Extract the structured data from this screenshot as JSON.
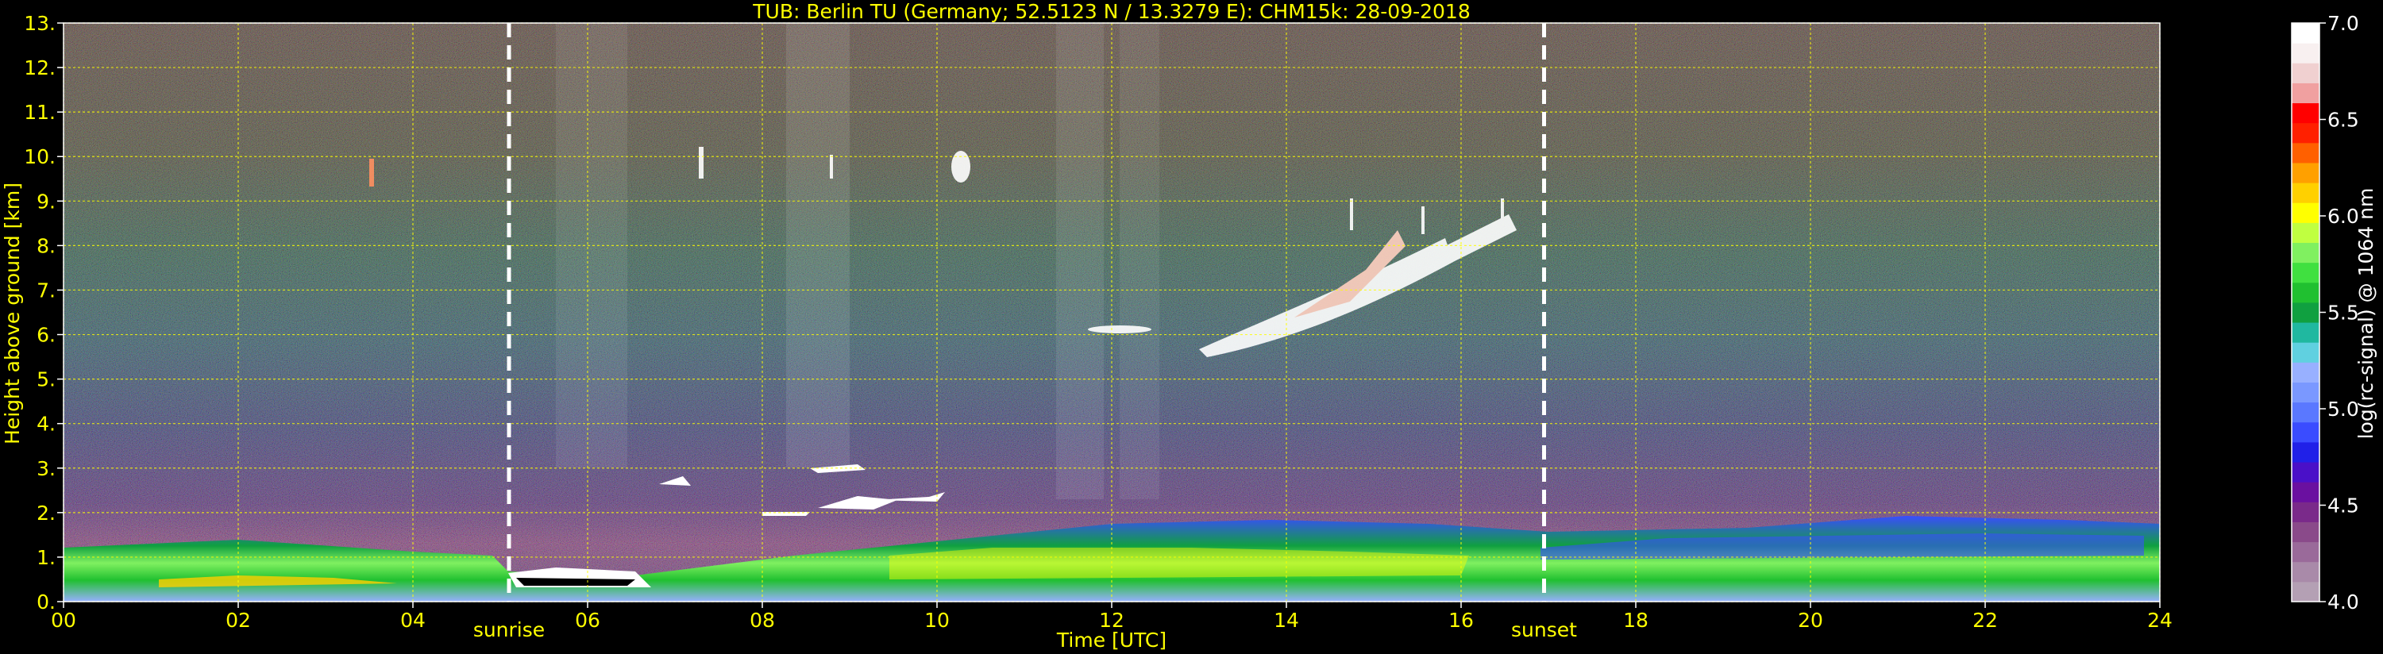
{
  "title": "TUB: Berlin TU (Germany; 52.5123 N / 13.3279 E):    CHM15k: 28-09-2018",
  "chart_data": {
    "type": "heatmap",
    "title": "TUB: Berlin TU (Germany; 52.5123 N / 13.3279 E):    CHM15k: 28-09-2018",
    "xlabel": "Time [UTC]",
    "ylabel": "Height above ground [km]",
    "xlim": [
      0,
      24
    ],
    "ylim": [
      0,
      13
    ],
    "x_ticks": [
      0,
      2,
      4,
      6,
      8,
      10,
      12,
      14,
      16,
      18,
      20,
      22,
      24
    ],
    "x_tick_labels": [
      "00",
      "02",
      "04",
      "06",
      "08",
      "10",
      "12",
      "14",
      "16",
      "18",
      "20",
      "22",
      "24"
    ],
    "y_ticks": [
      0,
      1,
      2,
      3,
      4,
      5,
      6,
      7,
      8,
      9,
      10,
      11,
      12,
      13
    ],
    "y_tick_labels": [
      "0.",
      "1.",
      "2.",
      "3.",
      "4.",
      "5.",
      "6.",
      "7.",
      "8.",
      "9.",
      "10.",
      "11.",
      "12.",
      "13."
    ],
    "grid": true,
    "colorbar": {
      "label": "log(rc-signal) @ 1064 nm",
      "range": [
        4.0,
        7.0
      ],
      "ticks": [
        4.0,
        4.5,
        5.0,
        5.5,
        6.0,
        6.5,
        7.0
      ],
      "tick_labels": [
        "4.0",
        "4.5",
        "5.0",
        "5.5",
        "6.0",
        "6.5",
        "7.0"
      ],
      "colors": [
        "#b4a0b4",
        "#a98aa9",
        "#9a6a9a",
        "#8a4a8a",
        "#7a2a8a",
        "#6a10a0",
        "#4a10c8",
        "#2020e8",
        "#3a4cff",
        "#5a78ff",
        "#7a98ff",
        "#98b0ff",
        "#60d0e0",
        "#20b8a0",
        "#10a040",
        "#20c030",
        "#40e040",
        "#80f060",
        "#c0ff40",
        "#ffff00",
        "#ffd000",
        "#ffa000",
        "#ff6000",
        "#ff2000",
        "#ff0000",
        "#f0a0a0",
        "#f0d0d0",
        "#f8f0f0",
        "#ffffff"
      ]
    },
    "annotations": [
      {
        "text": "sunrise",
        "x": 5.1
      },
      {
        "text": "sunset",
        "x": 16.95
      }
    ]
  }
}
